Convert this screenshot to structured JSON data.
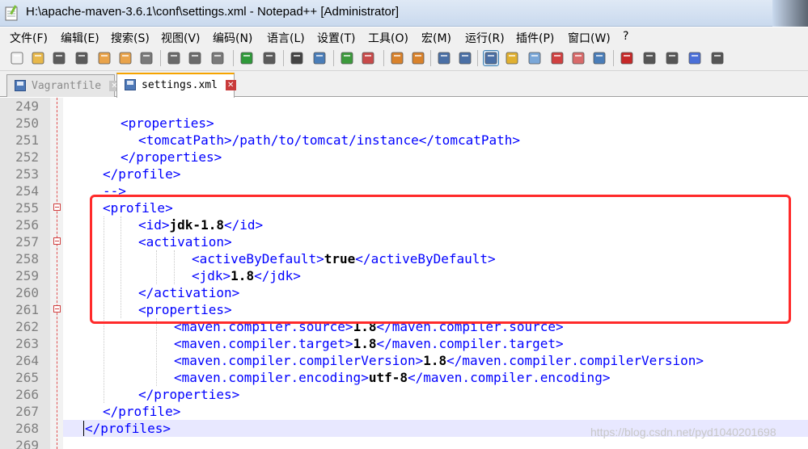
{
  "window": {
    "title": "H:\\apache-maven-3.6.1\\conf\\settings.xml - Notepad++ [Administrator]"
  },
  "menu": [
    {
      "label": "文件(F)"
    },
    {
      "label": "编辑(E)"
    },
    {
      "label": "搜索(S)"
    },
    {
      "label": "视图(V)"
    },
    {
      "label": "编码(N)"
    },
    {
      "label": "语言(L)"
    },
    {
      "label": "设置(T)"
    },
    {
      "label": "工具(O)"
    },
    {
      "label": "宏(M)"
    },
    {
      "label": "运行(R)"
    },
    {
      "label": "插件(P)"
    },
    {
      "label": "窗口(W)"
    },
    {
      "label": "?"
    }
  ],
  "toolbar": {
    "buttons": [
      {
        "icon": "new-file-icon",
        "color": "#f2f2f2"
      },
      {
        "icon": "open-file-icon",
        "color": "#e8b84a"
      },
      {
        "icon": "save-icon",
        "color": "#5b5b5b"
      },
      {
        "icon": "save-all-icon",
        "color": "#5b5b5b"
      },
      {
        "icon": "close-icon",
        "color": "#e9a34a"
      },
      {
        "icon": "close-all-icon",
        "color": "#e9a34a"
      },
      {
        "icon": "print-icon",
        "color": "#7a7a7a"
      },
      {
        "icon": "cut-icon",
        "color": "#6a6a6a"
      },
      {
        "icon": "copy-icon",
        "color": "#6a6a6a"
      },
      {
        "icon": "paste-icon",
        "color": "#7a7a7a"
      },
      {
        "icon": "undo-icon",
        "color": "#2f9a3a"
      },
      {
        "icon": "redo-icon",
        "color": "#5b5b5b"
      },
      {
        "icon": "find-icon",
        "color": "#444444"
      },
      {
        "icon": "replace-icon",
        "color": "#4a7db8"
      },
      {
        "icon": "zoom-in-icon",
        "color": "#3c9a3c"
      },
      {
        "icon": "zoom-out-icon",
        "color": "#c84a4a"
      },
      {
        "icon": "sync-vertical-icon",
        "color": "#d9822b"
      },
      {
        "icon": "sync-horizontal-icon",
        "color": "#d9822b"
      },
      {
        "icon": "word-wrap-icon",
        "color": "#4a6fa5"
      },
      {
        "icon": "show-all-chars-icon",
        "color": "#4a6fa5"
      },
      {
        "icon": "indent-guide-icon",
        "color": "#4a6fa5"
      },
      {
        "icon": "user-language-icon",
        "color": "#e0b030"
      },
      {
        "icon": "doc-map-icon",
        "color": "#7aa7d8"
      },
      {
        "icon": "function-list-icon",
        "color": "#d04040"
      },
      {
        "icon": "folder-workspace-icon",
        "color": "#d86a6a"
      },
      {
        "icon": "monitoring-icon",
        "color": "#4a7db8"
      },
      {
        "icon": "record-macro-icon",
        "color": "#c62828"
      },
      {
        "icon": "stop-macro-icon",
        "color": "#555555"
      },
      {
        "icon": "play-macro-icon",
        "color": "#555555"
      },
      {
        "icon": "run-macro-multiple-icon",
        "color": "#4a6fd8"
      },
      {
        "icon": "save-macro-icon",
        "color": "#555555"
      }
    ]
  },
  "tabs": [
    {
      "label": "Vagrantfile",
      "active": false
    },
    {
      "label": "settings.xml",
      "active": true
    }
  ],
  "editor": {
    "lines": [
      {
        "n": "249",
        "segments": [],
        "fold": false
      },
      {
        "n": "250",
        "segments": [
          {
            "t": "<properties>",
            "v": false
          }
        ],
        "fold": false
      },
      {
        "n": "251",
        "segments": [
          {
            "t": "<tomcatPath>/path/to/tomcat/instance</tomcatPath>",
            "v": false
          }
        ],
        "fold": false
      },
      {
        "n": "252",
        "segments": [
          {
            "t": "</properties>",
            "v": false
          }
        ],
        "fold": false
      },
      {
        "n": "253",
        "segments": [
          {
            "t": "</profile>",
            "v": false
          }
        ],
        "fold": false
      },
      {
        "n": "254",
        "segments": [
          {
            "t": "-->",
            "v": false
          }
        ],
        "fold": false
      },
      {
        "n": "255",
        "segments": [
          {
            "t": "<profile>",
            "v": false
          }
        ],
        "fold": true
      },
      {
        "n": "256",
        "segments": [
          {
            "t": "<id>",
            "v": false
          },
          {
            "t": "jdk-1.8",
            "v": true
          },
          {
            "t": "</id>",
            "v": false
          }
        ],
        "fold": false
      },
      {
        "n": "257",
        "segments": [
          {
            "t": "<activation>",
            "v": false
          }
        ],
        "fold": true
      },
      {
        "n": "258",
        "segments": [
          {
            "t": "<activeByDefault>",
            "v": false
          },
          {
            "t": "true",
            "v": true
          },
          {
            "t": "</activeByDefault>",
            "v": false
          }
        ],
        "fold": false
      },
      {
        "n": "259",
        "segments": [
          {
            "t": "<jdk>",
            "v": false
          },
          {
            "t": "1.8",
            "v": true
          },
          {
            "t": "</jdk>",
            "v": false
          }
        ],
        "fold": false
      },
      {
        "n": "260",
        "segments": [
          {
            "t": "</activation>",
            "v": false
          }
        ],
        "fold": false
      },
      {
        "n": "261",
        "segments": [
          {
            "t": "<properties>",
            "v": false
          }
        ],
        "fold": true
      },
      {
        "n": "262",
        "segments": [
          {
            "t": "<maven.compiler.source>",
            "v": false
          },
          {
            "t": "1.8",
            "v": true
          },
          {
            "t": "</maven.compiler.source>",
            "v": false
          }
        ],
        "fold": false
      },
      {
        "n": "263",
        "segments": [
          {
            "t": "<maven.compiler.target>",
            "v": false
          },
          {
            "t": "1.8",
            "v": true
          },
          {
            "t": "</maven.compiler.target>",
            "v": false
          }
        ],
        "fold": false
      },
      {
        "n": "264",
        "segments": [
          {
            "t": "<maven.compiler.compilerVersion>",
            "v": false
          },
          {
            "t": "1.8",
            "v": true
          },
          {
            "t": "</maven.compiler.compilerVersion>",
            "v": false
          }
        ],
        "fold": false
      },
      {
        "n": "265",
        "segments": [
          {
            "t": "<maven.compiler.encoding>",
            "v": false
          },
          {
            "t": "utf-8",
            "v": true
          },
          {
            "t": "</maven.compiler.encoding>",
            "v": false
          }
        ],
        "fold": false
      },
      {
        "n": "266",
        "segments": [
          {
            "t": "</properties>",
            "v": false
          }
        ],
        "fold": false
      },
      {
        "n": "267",
        "segments": [
          {
            "t": "</profile>",
            "v": false
          }
        ],
        "fold": false
      },
      {
        "n": "268",
        "segments": [
          {
            "t": "</profiles>",
            "v": false
          }
        ],
        "fold": false,
        "current": true
      },
      {
        "n": "269",
        "segments": [],
        "fold": false
      }
    ]
  },
  "watermark": "https://blog.csdn.net/pyd1040201698",
  "colors": {
    "tag": "#0000ff",
    "value": "#000000",
    "highlight_border": "#ff2a2a"
  }
}
